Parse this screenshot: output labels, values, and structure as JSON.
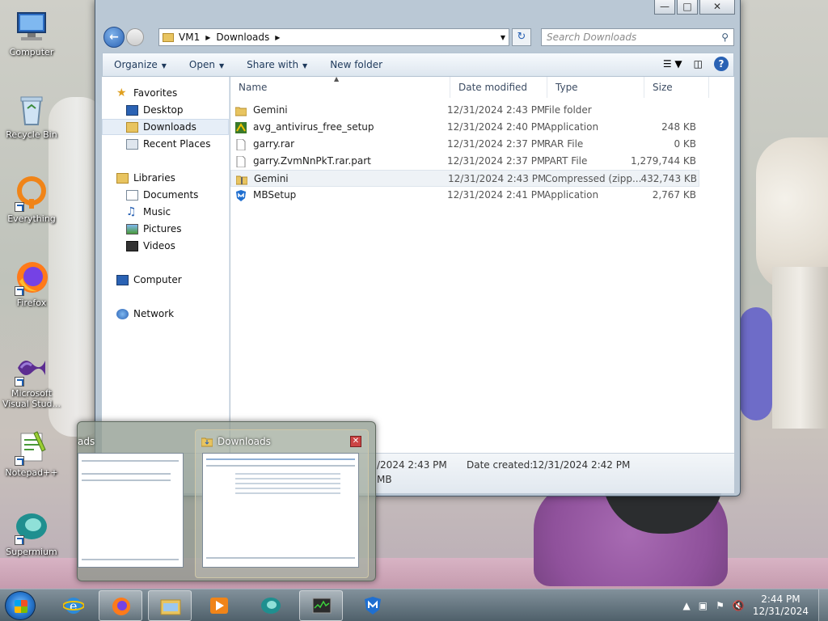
{
  "desktop": {
    "icons": [
      {
        "label": "Computer",
        "icon": "computer-icon"
      },
      {
        "label": "Recycle Bin",
        "icon": "recycle-bin-icon"
      },
      {
        "label": "Everything",
        "icon": "everything-icon"
      },
      {
        "label": "Firefox",
        "icon": "firefox-icon"
      },
      {
        "label": "Microsoft Visual Stud...",
        "icon": "visual-studio-icon"
      },
      {
        "label": "Notepad++",
        "icon": "notepad-plus-plus-icon"
      },
      {
        "label": "Supermium",
        "icon": "supermium-icon"
      }
    ]
  },
  "window": {
    "title_buttons": {
      "minimize": "—",
      "maximize": "□",
      "close": "✕"
    },
    "address": {
      "segments": [
        "VM1",
        "Downloads"
      ]
    },
    "search": {
      "placeholder": "Search Downloads"
    },
    "toolbar": {
      "organize": "Organize",
      "open": "Open",
      "share_with": "Share with",
      "new_folder": "New folder",
      "help": "?"
    },
    "nav": {
      "favorites": "Favorites",
      "desktop": "Desktop",
      "downloads": "Downloads",
      "recent_places": "Recent Places",
      "libraries": "Libraries",
      "documents": "Documents",
      "music": "Music",
      "pictures": "Pictures",
      "videos": "Videos",
      "computer": "Computer",
      "network": "Network"
    },
    "columns": {
      "name": "Name",
      "date": "Date modified",
      "type": "Type",
      "size": "Size"
    },
    "files": [
      {
        "name": "Gemini",
        "date": "12/31/2024 2:43 PM",
        "type": "File folder",
        "size": "",
        "icon": "folder-icon"
      },
      {
        "name": "avg_antivirus_free_setup",
        "date": "12/31/2024 2:40 PM",
        "type": "Application",
        "size": "248 KB",
        "icon": "avg-installer-icon"
      },
      {
        "name": "garry.rar",
        "date": "12/31/2024 2:37 PM",
        "type": "RAR File",
        "size": "0 KB",
        "icon": "blank-file-icon"
      },
      {
        "name": "garry.ZvmNnPkT.rar.part",
        "date": "12/31/2024 2:37 PM",
        "type": "PART File",
        "size": "1,279,744 KB",
        "icon": "blank-file-icon"
      },
      {
        "name": "Gemini",
        "date": "12/31/2024 2:43 PM",
        "type": "Compressed (zipp...",
        "size": "432,743 KB",
        "icon": "zip-folder-icon"
      },
      {
        "name": "MBSetup",
        "date": "12/31/2024 2:41 PM",
        "type": "Application",
        "size": "2,767 KB",
        "icon": "malwarebytes-icon"
      }
    ],
    "details": {
      "date_modified_partial": "/2024 2:43 PM",
      "date_created_label": "Date created:",
      "date_created": "12/31/2024 2:42 PM",
      "size_partial": "MB"
    }
  },
  "thumbnails": {
    "left_title": "ads",
    "right_title": "Downloads",
    "close": "✕"
  },
  "taskbar": {
    "clock_time": "2:44 PM",
    "clock_date": "12/31/2024",
    "tray_chevron": "▲"
  },
  "colors": {
    "accent": "#2a62b4",
    "folder": "#e8c460",
    "taskbar": "#4c6270"
  }
}
